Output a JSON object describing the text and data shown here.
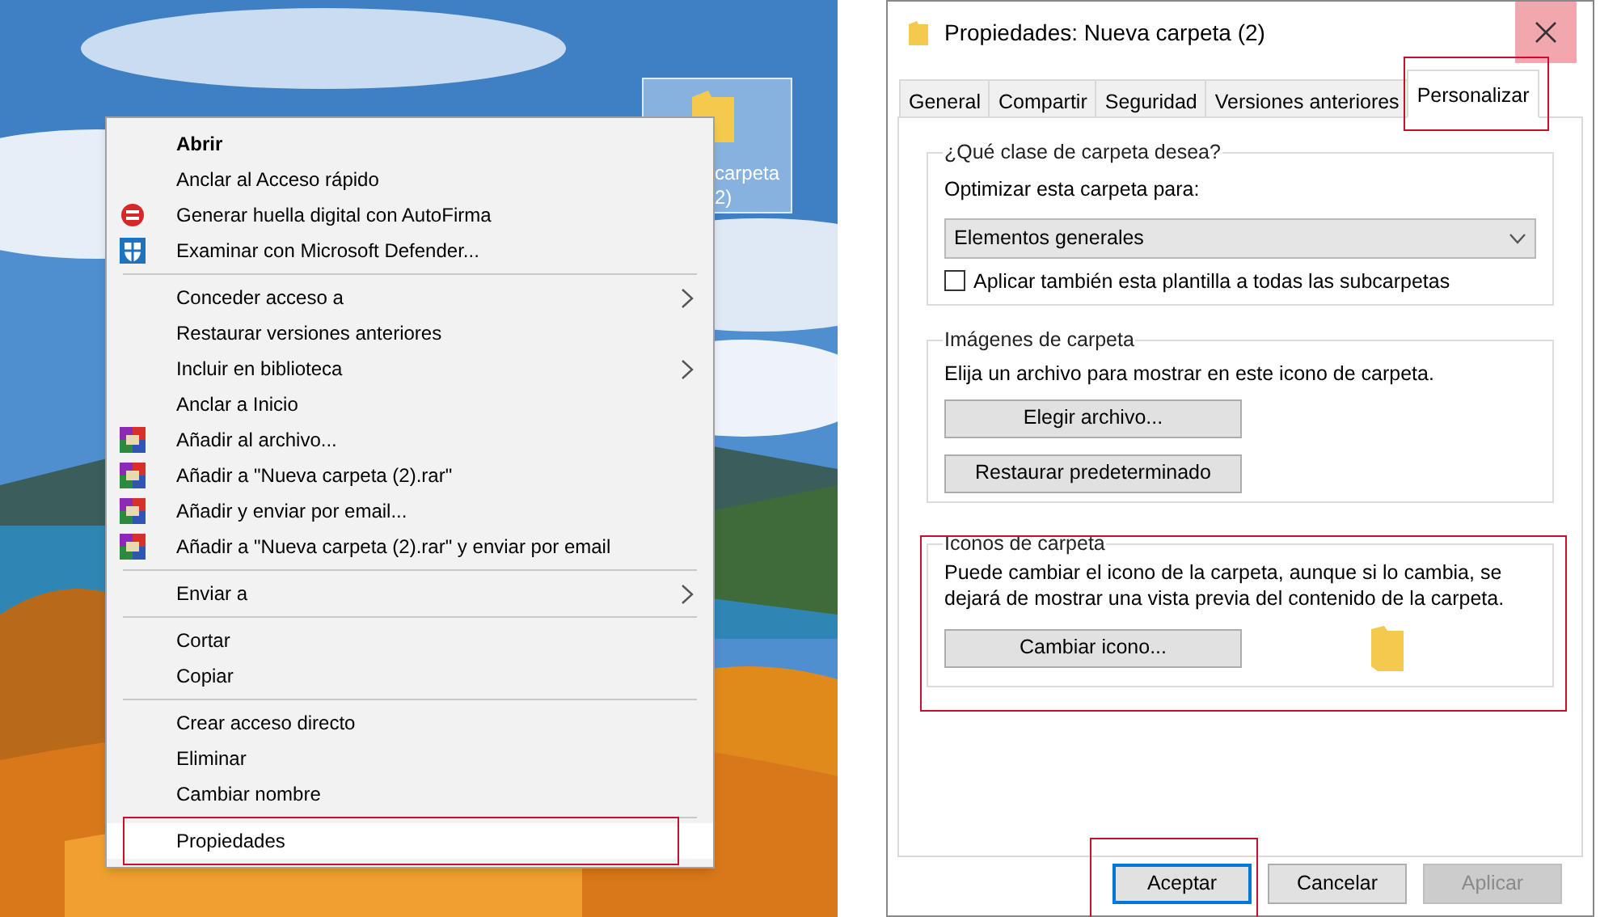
{
  "desktop": {
    "icon_label_lines": [
      "carpeta",
      "2)"
    ]
  },
  "context_menu": {
    "groups": [
      [
        {
          "label": "Abrir",
          "kind": "plain",
          "bold": true,
          "submenu": false,
          "selected": false
        },
        {
          "label": "Anclar al Acceso rápido",
          "kind": "plain",
          "bold": false,
          "submenu": false,
          "selected": false
        },
        {
          "label": "Generar huella digital con AutoFirma",
          "kind": "autofirma",
          "bold": false,
          "submenu": false,
          "selected": false
        },
        {
          "label": "Examinar con Microsoft Defender...",
          "kind": "defender",
          "bold": false,
          "submenu": false,
          "selected": false
        }
      ],
      [
        {
          "label": "Conceder acceso a",
          "kind": "plain",
          "bold": false,
          "submenu": true,
          "selected": false
        },
        {
          "label": "Restaurar versiones anteriores",
          "kind": "plain",
          "bold": false,
          "submenu": false,
          "selected": false
        },
        {
          "label": "Incluir en biblioteca",
          "kind": "plain",
          "bold": false,
          "submenu": true,
          "selected": false
        },
        {
          "label": "Anclar a Inicio",
          "kind": "plain",
          "bold": false,
          "submenu": false,
          "selected": false
        },
        {
          "label": "Añadir al archivo...",
          "kind": "archive",
          "bold": false,
          "submenu": false,
          "selected": false
        },
        {
          "label": "Añadir a \"Nueva carpeta (2).rar\"",
          "kind": "archive",
          "bold": false,
          "submenu": false,
          "selected": false
        },
        {
          "label": "Añadir y enviar por email...",
          "kind": "archive",
          "bold": false,
          "submenu": false,
          "selected": false
        },
        {
          "label": "Añadir a \"Nueva carpeta (2).rar\" y enviar por email",
          "kind": "archive",
          "bold": false,
          "submenu": false,
          "selected": false
        }
      ],
      [
        {
          "label": "Enviar a",
          "kind": "plain",
          "bold": false,
          "submenu": true,
          "selected": false
        }
      ],
      [
        {
          "label": "Cortar",
          "kind": "plain",
          "bold": false,
          "submenu": false,
          "selected": false
        },
        {
          "label": "Copiar",
          "kind": "plain",
          "bold": false,
          "submenu": false,
          "selected": false
        }
      ],
      [
        {
          "label": "Crear acceso directo",
          "kind": "plain",
          "bold": false,
          "submenu": false,
          "selected": false
        },
        {
          "label": "Eliminar",
          "kind": "plain",
          "bold": false,
          "submenu": false,
          "selected": false
        },
        {
          "label": "Cambiar nombre",
          "kind": "plain",
          "bold": false,
          "submenu": false,
          "selected": false
        }
      ],
      [
        {
          "label": "Propiedades",
          "kind": "plain",
          "bold": false,
          "submenu": false,
          "selected": true
        }
      ]
    ]
  },
  "dialog": {
    "title": "Propiedades: Nueva carpeta (2)",
    "tabs": [
      {
        "label": "General",
        "selected": false,
        "highlighted": false
      },
      {
        "label": "Compartir",
        "selected": false,
        "highlighted": false
      },
      {
        "label": "Seguridad",
        "selected": false,
        "highlighted": false
      },
      {
        "label": "Versiones anteriores",
        "selected": false,
        "highlighted": false
      },
      {
        "label": "Personalizar",
        "selected": true,
        "highlighted": true
      }
    ],
    "folder_type": {
      "legend": "¿Qué clase de carpeta desea?",
      "label": "Optimizar esta carpeta para:",
      "dropdown": "Elementos generales",
      "checkbox": {
        "label": "Aplicar también esta plantilla a todas las subcarpetas",
        "checked": false
      },
      "highlighted": false
    },
    "folder_pictures": {
      "legend": "Imágenes de carpeta",
      "text": "Elija un archivo para mostrar en este icono de carpeta.",
      "buttons": [
        "Elegir archivo...",
        "Restaurar predeterminado"
      ],
      "highlighted": false
    },
    "folder_icons": {
      "legend": "Iconos de carpeta",
      "text": "Puede cambiar el icono de la carpeta, aunque si lo cambia, se dejará de mostrar una vista previa del contenido de la carpeta.",
      "button": "Cambiar icono...",
      "highlighted": true
    },
    "buttons": [
      {
        "label": "Aceptar",
        "default": true,
        "disabled": false,
        "highlighted": true
      },
      {
        "label": "Cancelar",
        "default": false,
        "disabled": false,
        "highlighted": false
      },
      {
        "label": "Aplicar",
        "default": false,
        "disabled": true,
        "highlighted": false
      }
    ]
  }
}
